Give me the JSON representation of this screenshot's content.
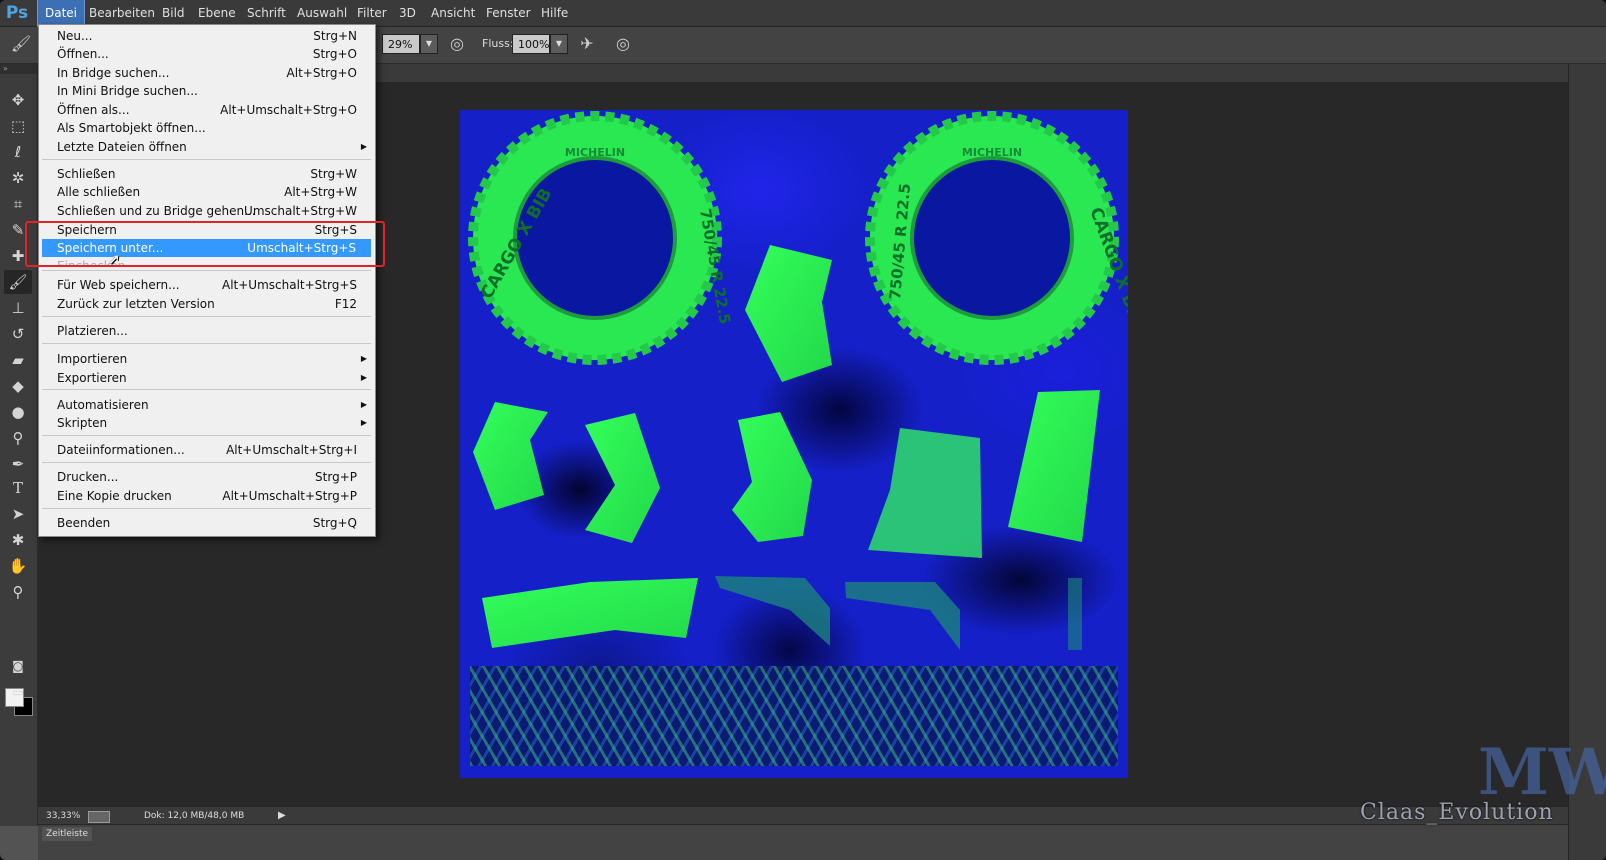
{
  "app": {
    "logo": "Ps"
  },
  "menubar": [
    {
      "label": "Datei"
    },
    {
      "label": "Bearbeiten"
    },
    {
      "label": "Bild"
    },
    {
      "label": "Ebene"
    },
    {
      "label": "Schrift"
    },
    {
      "label": "Auswahl"
    },
    {
      "label": "Filter"
    },
    {
      "label": "3D"
    },
    {
      "label": "Ansicht"
    },
    {
      "label": "Fenster"
    },
    {
      "label": "Hilfe"
    }
  ],
  "options": {
    "opacity_value": "29%",
    "flow_label": "Fluss:",
    "flow_value": "100%"
  },
  "file_menu": {
    "items": [
      {
        "label": "Neu...",
        "shortcut": "Strg+N"
      },
      {
        "label": "Öffnen...",
        "shortcut": "Strg+O"
      },
      {
        "label": "In Bridge suchen...",
        "shortcut": "Alt+Strg+O"
      },
      {
        "label": "In Mini Bridge suchen...",
        "shortcut": ""
      },
      {
        "label": "Öffnen als...",
        "shortcut": "Alt+Umschalt+Strg+O"
      },
      {
        "label": "Als Smartobjekt öffnen...",
        "shortcut": ""
      },
      {
        "label": "Letzte Dateien öffnen",
        "shortcut": ""
      },
      {
        "label": "Schließen",
        "shortcut": "Strg+W"
      },
      {
        "label": "Alle schließen",
        "shortcut": "Alt+Strg+W"
      },
      {
        "label": "Schließen und zu Bridge gehen...",
        "shortcut": "Umschalt+Strg+W"
      },
      {
        "label": "Speichern",
        "shortcut": "Strg+S"
      },
      {
        "label": "Speichern unter...",
        "shortcut": "Umschalt+Strg+S"
      },
      {
        "label": "Einchecken",
        "shortcut": ""
      },
      {
        "label": "Für Web speichern...",
        "shortcut": "Alt+Umschalt+Strg+S"
      },
      {
        "label": "Zurück zur letzten Version",
        "shortcut": "F12"
      },
      {
        "label": "Platzieren...",
        "shortcut": ""
      },
      {
        "label": "Importieren",
        "shortcut": ""
      },
      {
        "label": "Exportieren",
        "shortcut": ""
      },
      {
        "label": "Automatisieren",
        "shortcut": ""
      },
      {
        "label": "Skripten",
        "shortcut": ""
      },
      {
        "label": "Dateiinformationen...",
        "shortcut": "Alt+Umschalt+Strg+I"
      },
      {
        "label": "Drucken...",
        "shortcut": "Strg+P"
      },
      {
        "label": "Eine Kopie drucken",
        "shortcut": "Alt+Umschalt+Strg+P"
      },
      {
        "label": "Beenden",
        "shortcut": "Strg+Q"
      }
    ],
    "highlighted": "Speichern unter..."
  },
  "canvas": {
    "tire_brand": "MICHELIN",
    "tire_model": "CARGO X BIB",
    "tire_size": "750/45 R 22.5"
  },
  "status": {
    "zoom": "33,33%",
    "doc": "Dok: 12,0 MB/48,0 MB"
  },
  "timeline": {
    "tab": "Zeitleiste"
  },
  "watermark": {
    "text": "Claas_Evolution",
    "logo": "MW"
  },
  "colors": {
    "accent": "#3399ff",
    "highlight_frame": "#e2242a",
    "canvas_bg": "#1520c8",
    "uv_green": "#3cff4a"
  }
}
